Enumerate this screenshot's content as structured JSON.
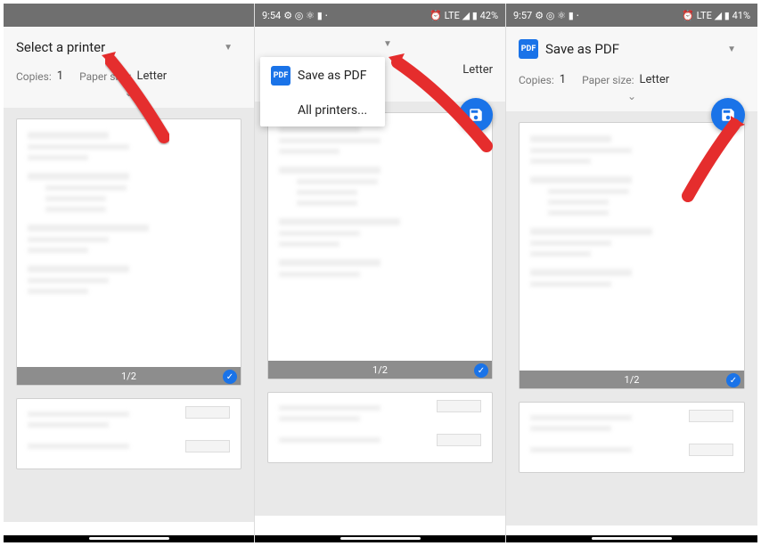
{
  "screens": [
    {
      "status": {
        "time": "",
        "icons": "",
        "right": ""
      },
      "printer_label": "Select a printer",
      "show_pdf_icon": false,
      "copies_label": "Copies:",
      "copies_value": "1",
      "paper_label": "Paper size:",
      "paper_value": "Letter",
      "show_fab": false,
      "dropdown_open": false,
      "page_indicator": "1/2"
    },
    {
      "status": {
        "time": "9:54",
        "icons": "⚙ ◎ ⚛ ▮ ⋅",
        "right": "⏰ LTE ◢ ▮ 42%"
      },
      "printer_label": "Save as PDF",
      "show_pdf_icon": true,
      "copies_label": "",
      "copies_value": "",
      "paper_label": "",
      "paper_value": "Letter",
      "show_fab": true,
      "dropdown_open": true,
      "dropdown_items": [
        "Save as PDF",
        "All printers..."
      ],
      "page_indicator": "1/2"
    },
    {
      "status": {
        "time": "9:57",
        "icons": "⚙ ◎ ⚛ ▮ ⋅",
        "right": "⏰ LTE ◢ ▮ 41%"
      },
      "printer_label": "Save as PDF",
      "show_pdf_icon": true,
      "copies_label": "Copies:",
      "copies_value": "1",
      "paper_label": "Paper size:",
      "paper_value": "Letter",
      "show_fab": true,
      "dropdown_open": false,
      "page_indicator": "1/2"
    }
  ],
  "pdf_badge": "PDF"
}
